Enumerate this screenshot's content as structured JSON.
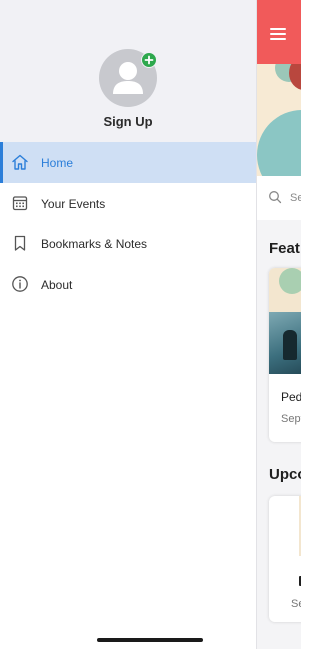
{
  "drawer": {
    "signup_label": "Sign Up",
    "menu": [
      {
        "label": "Home",
        "icon": "home-icon",
        "active": true
      },
      {
        "label": "Your Events",
        "icon": "calendar-icon",
        "active": false
      },
      {
        "label": "Bookmarks & Notes",
        "icon": "bookmark-icon",
        "active": false
      },
      {
        "label": "About",
        "icon": "info-icon",
        "active": false
      }
    ]
  },
  "background_app": {
    "search_placeholder": "Se",
    "featured_title": "Feat",
    "upcoming_title": "Upco",
    "card1_title": "Ped",
    "card1_date": "Sept",
    "card2_date": "Se"
  },
  "colors": {
    "accent": "#2b7ed9",
    "active_bg": "#cfdff4",
    "appbar": "#f15a5a",
    "badge": "#2ea84d"
  }
}
